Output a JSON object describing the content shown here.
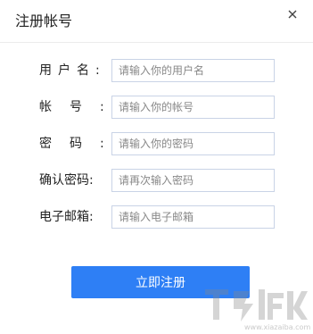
{
  "window": {
    "title": "注册帐号",
    "close_icon": "close-icon"
  },
  "form": {
    "fields": [
      {
        "label": "用户名:",
        "placeholder": "请输入你的用户名",
        "value": ""
      },
      {
        "label": "帐号:",
        "placeholder": "请输入你的帐号",
        "value": ""
      },
      {
        "label": "密码:",
        "placeholder": "请输入你的密码",
        "value": ""
      },
      {
        "label": "确认密码:",
        "placeholder": "请再次输入密码",
        "value": ""
      },
      {
        "label": "电子邮箱:",
        "placeholder": "请输入电子邮箱",
        "value": ""
      }
    ],
    "submit_label": "立即注册"
  },
  "watermark": {
    "logo": "download-site-logo",
    "text": "www.xiazaiba.com"
  },
  "colors": {
    "accent": "#2e7ff5",
    "field_border": "#c9d3e6"
  }
}
